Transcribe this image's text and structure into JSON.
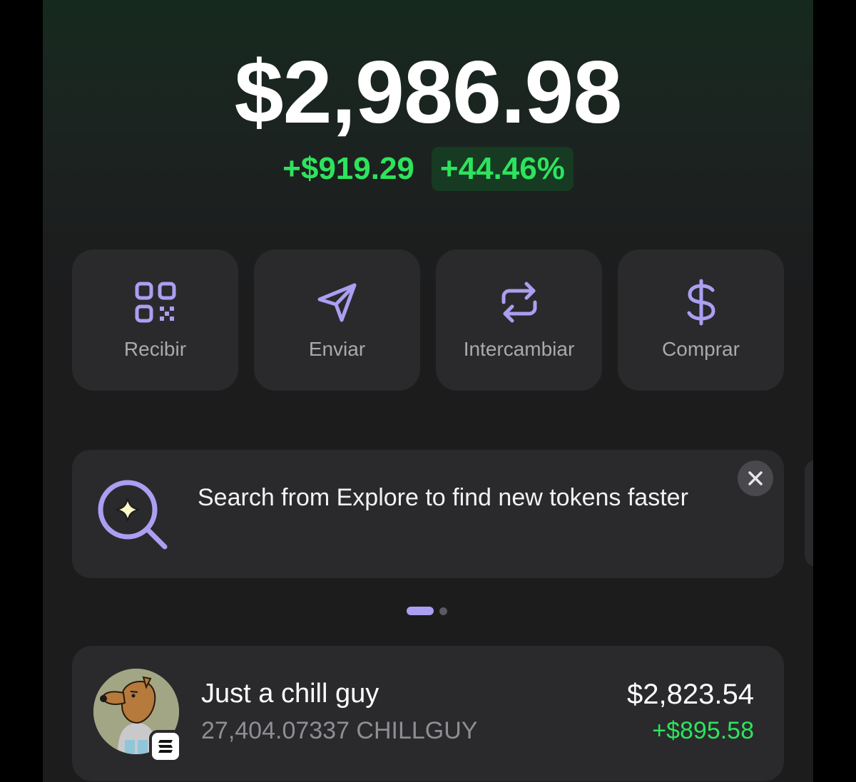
{
  "portfolio": {
    "balance": "$2,986.98",
    "change_amount": "+$919.29",
    "change_percent": "+44.46%"
  },
  "actions": [
    {
      "label": "Recibir",
      "icon": "qr-code-icon"
    },
    {
      "label": "Enviar",
      "icon": "send-icon"
    },
    {
      "label": "Intercambiar",
      "icon": "swap-icon"
    },
    {
      "label": "Comprar",
      "icon": "dollar-icon"
    }
  ],
  "banner": {
    "text": "Search from Explore to find new tokens faster",
    "icon": "search-sparkle-icon",
    "close_icon": "close-icon"
  },
  "pagination": {
    "count": 2,
    "active": 1
  },
  "tokens": [
    {
      "name": "Just a chill guy",
      "amount": "27,404.07337 CHILLGUY",
      "value": "$2,823.54",
      "change": "+$895.58",
      "chain_icon": "solana-icon"
    }
  ],
  "colors": {
    "accent": "#ab9ff2",
    "positive": "#2ee35d",
    "card": "#2a2a2d",
    "background": "#1c1c1d"
  }
}
